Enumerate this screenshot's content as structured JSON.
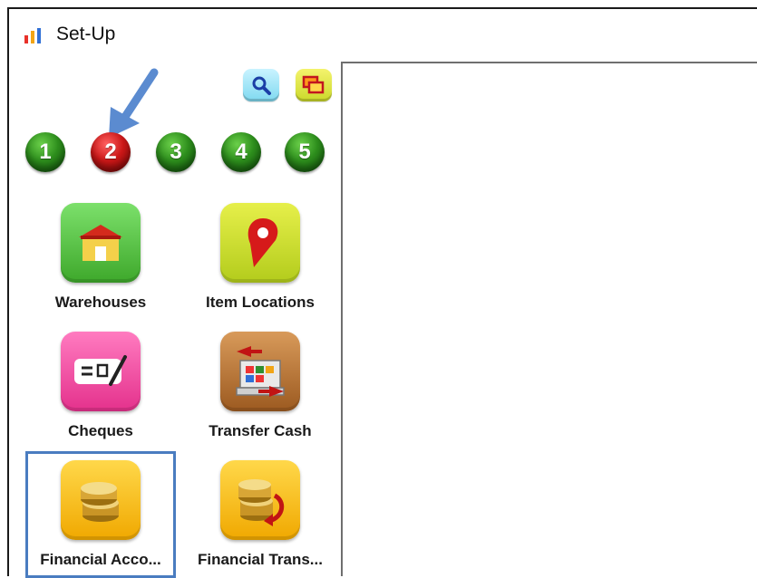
{
  "window": {
    "title": "Set-Up",
    "app_icon": "bar-chart-icon"
  },
  "toolbar": {
    "search_icon": "search-icon",
    "window_icon": "windows-icon"
  },
  "pages": [
    {
      "label": "1",
      "state": "inactive",
      "color": "#2e8f1d"
    },
    {
      "label": "2",
      "state": "active",
      "color": "#cc1818"
    },
    {
      "label": "3",
      "state": "inactive",
      "color": "#2e8f1d"
    },
    {
      "label": "4",
      "state": "inactive",
      "color": "#2e8f1d"
    },
    {
      "label": "5",
      "state": "inactive",
      "color": "#2e8f1d"
    }
  ],
  "tiles": [
    {
      "label": "Warehouses",
      "icon": "warehouse-icon"
    },
    {
      "label": "Item Locations",
      "icon": "map-pin-icon"
    },
    {
      "label": "Cheques",
      "icon": "cheque-icon"
    },
    {
      "label": "Transfer Cash",
      "icon": "cash-register-icon"
    },
    {
      "label": "Financial Acco...",
      "icon": "coins-icon",
      "selected": true
    },
    {
      "label": "Financial Trans...",
      "icon": "coins-transfer-icon"
    }
  ],
  "colors": {
    "selection_outline": "#4a7cc0",
    "annotation_arrow": "#5b8bd0"
  }
}
